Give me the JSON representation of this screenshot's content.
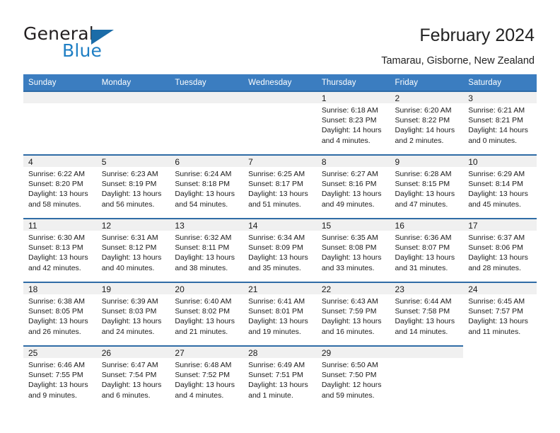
{
  "brand": {
    "name_top": "General",
    "name_bottom": "Blue",
    "triangle_color": "#1b6ca8",
    "text_color": "#231f20",
    "blue_color": "#1f7fc4"
  },
  "header": {
    "title": "February 2024",
    "subtitle": "Tamarau, Gisborne, New Zealand"
  },
  "theme": {
    "header_bg": "#3b7dc0",
    "header_text": "#ffffff",
    "day_band_bg": "#f0f0f0",
    "row_rule": "#2f6ca6",
    "body_bg": "#ffffff"
  },
  "calendar": {
    "weekday_headers": [
      "Sunday",
      "Monday",
      "Tuesday",
      "Wednesday",
      "Thursday",
      "Friday",
      "Saturday"
    ],
    "weeks": [
      [
        {
          "day": "",
          "state": "blank-band",
          "sunrise": "",
          "sunset": "",
          "daylight": ""
        },
        {
          "day": "",
          "state": "blank-band",
          "sunrise": "",
          "sunset": "",
          "daylight": ""
        },
        {
          "day": "",
          "state": "blank-band",
          "sunrise": "",
          "sunset": "",
          "daylight": ""
        },
        {
          "day": "",
          "state": "blank-band",
          "sunrise": "",
          "sunset": "",
          "daylight": ""
        },
        {
          "day": "1",
          "state": "filled",
          "sunrise": "Sunrise: 6:18 AM",
          "sunset": "Sunset: 8:23 PM",
          "daylight": "Daylight: 14 hours and 4 minutes."
        },
        {
          "day": "2",
          "state": "filled",
          "sunrise": "Sunrise: 6:20 AM",
          "sunset": "Sunset: 8:22 PM",
          "daylight": "Daylight: 14 hours and 2 minutes."
        },
        {
          "day": "3",
          "state": "filled",
          "sunrise": "Sunrise: 6:21 AM",
          "sunset": "Sunset: 8:21 PM",
          "daylight": "Daylight: 14 hours and 0 minutes."
        }
      ],
      [
        {
          "day": "4",
          "state": "filled",
          "sunrise": "Sunrise: 6:22 AM",
          "sunset": "Sunset: 8:20 PM",
          "daylight": "Daylight: 13 hours and 58 minutes."
        },
        {
          "day": "5",
          "state": "filled",
          "sunrise": "Sunrise: 6:23 AM",
          "sunset": "Sunset: 8:19 PM",
          "daylight": "Daylight: 13 hours and 56 minutes."
        },
        {
          "day": "6",
          "state": "filled",
          "sunrise": "Sunrise: 6:24 AM",
          "sunset": "Sunset: 8:18 PM",
          "daylight": "Daylight: 13 hours and 54 minutes."
        },
        {
          "day": "7",
          "state": "filled",
          "sunrise": "Sunrise: 6:25 AM",
          "sunset": "Sunset: 8:17 PM",
          "daylight": "Daylight: 13 hours and 51 minutes."
        },
        {
          "day": "8",
          "state": "filled",
          "sunrise": "Sunrise: 6:27 AM",
          "sunset": "Sunset: 8:16 PM",
          "daylight": "Daylight: 13 hours and 49 minutes."
        },
        {
          "day": "9",
          "state": "filled",
          "sunrise": "Sunrise: 6:28 AM",
          "sunset": "Sunset: 8:15 PM",
          "daylight": "Daylight: 13 hours and 47 minutes."
        },
        {
          "day": "10",
          "state": "filled",
          "sunrise": "Sunrise: 6:29 AM",
          "sunset": "Sunset: 8:14 PM",
          "daylight": "Daylight: 13 hours and 45 minutes."
        }
      ],
      [
        {
          "day": "11",
          "state": "filled",
          "sunrise": "Sunrise: 6:30 AM",
          "sunset": "Sunset: 8:13 PM",
          "daylight": "Daylight: 13 hours and 42 minutes."
        },
        {
          "day": "12",
          "state": "filled",
          "sunrise": "Sunrise: 6:31 AM",
          "sunset": "Sunset: 8:12 PM",
          "daylight": "Daylight: 13 hours and 40 minutes."
        },
        {
          "day": "13",
          "state": "filled",
          "sunrise": "Sunrise: 6:32 AM",
          "sunset": "Sunset: 8:11 PM",
          "daylight": "Daylight: 13 hours and 38 minutes."
        },
        {
          "day": "14",
          "state": "filled",
          "sunrise": "Sunrise: 6:34 AM",
          "sunset": "Sunset: 8:09 PM",
          "daylight": "Daylight: 13 hours and 35 minutes."
        },
        {
          "day": "15",
          "state": "filled",
          "sunrise": "Sunrise: 6:35 AM",
          "sunset": "Sunset: 8:08 PM",
          "daylight": "Daylight: 13 hours and 33 minutes."
        },
        {
          "day": "16",
          "state": "filled",
          "sunrise": "Sunrise: 6:36 AM",
          "sunset": "Sunset: 8:07 PM",
          "daylight": "Daylight: 13 hours and 31 minutes."
        },
        {
          "day": "17",
          "state": "filled",
          "sunrise": "Sunrise: 6:37 AM",
          "sunset": "Sunset: 8:06 PM",
          "daylight": "Daylight: 13 hours and 28 minutes."
        }
      ],
      [
        {
          "day": "18",
          "state": "filled",
          "sunrise": "Sunrise: 6:38 AM",
          "sunset": "Sunset: 8:05 PM",
          "daylight": "Daylight: 13 hours and 26 minutes."
        },
        {
          "day": "19",
          "state": "filled",
          "sunrise": "Sunrise: 6:39 AM",
          "sunset": "Sunset: 8:03 PM",
          "daylight": "Daylight: 13 hours and 24 minutes."
        },
        {
          "day": "20",
          "state": "filled",
          "sunrise": "Sunrise: 6:40 AM",
          "sunset": "Sunset: 8:02 PM",
          "daylight": "Daylight: 13 hours and 21 minutes."
        },
        {
          "day": "21",
          "state": "filled",
          "sunrise": "Sunrise: 6:41 AM",
          "sunset": "Sunset: 8:01 PM",
          "daylight": "Daylight: 13 hours and 19 minutes."
        },
        {
          "day": "22",
          "state": "filled",
          "sunrise": "Sunrise: 6:43 AM",
          "sunset": "Sunset: 7:59 PM",
          "daylight": "Daylight: 13 hours and 16 minutes."
        },
        {
          "day": "23",
          "state": "filled",
          "sunrise": "Sunrise: 6:44 AM",
          "sunset": "Sunset: 7:58 PM",
          "daylight": "Daylight: 13 hours and 14 minutes."
        },
        {
          "day": "24",
          "state": "filled",
          "sunrise": "Sunrise: 6:45 AM",
          "sunset": "Sunset: 7:57 PM",
          "daylight": "Daylight: 13 hours and 11 minutes."
        }
      ],
      [
        {
          "day": "25",
          "state": "filled",
          "sunrise": "Sunrise: 6:46 AM",
          "sunset": "Sunset: 7:55 PM",
          "daylight": "Daylight: 13 hours and 9 minutes."
        },
        {
          "day": "26",
          "state": "filled",
          "sunrise": "Sunrise: 6:47 AM",
          "sunset": "Sunset: 7:54 PM",
          "daylight": "Daylight: 13 hours and 6 minutes."
        },
        {
          "day": "27",
          "state": "filled",
          "sunrise": "Sunrise: 6:48 AM",
          "sunset": "Sunset: 7:52 PM",
          "daylight": "Daylight: 13 hours and 4 minutes."
        },
        {
          "day": "28",
          "state": "filled",
          "sunrise": "Sunrise: 6:49 AM",
          "sunset": "Sunset: 7:51 PM",
          "daylight": "Daylight: 13 hours and 1 minute."
        },
        {
          "day": "29",
          "state": "filled",
          "sunrise": "Sunrise: 6:50 AM",
          "sunset": "Sunset: 7:50 PM",
          "daylight": "Daylight: 12 hours and 59 minutes."
        },
        {
          "day": "",
          "state": "blank-band",
          "sunrise": "",
          "sunset": "",
          "daylight": ""
        },
        {
          "day": "",
          "state": "empty",
          "sunrise": "",
          "sunset": "",
          "daylight": ""
        }
      ]
    ]
  }
}
